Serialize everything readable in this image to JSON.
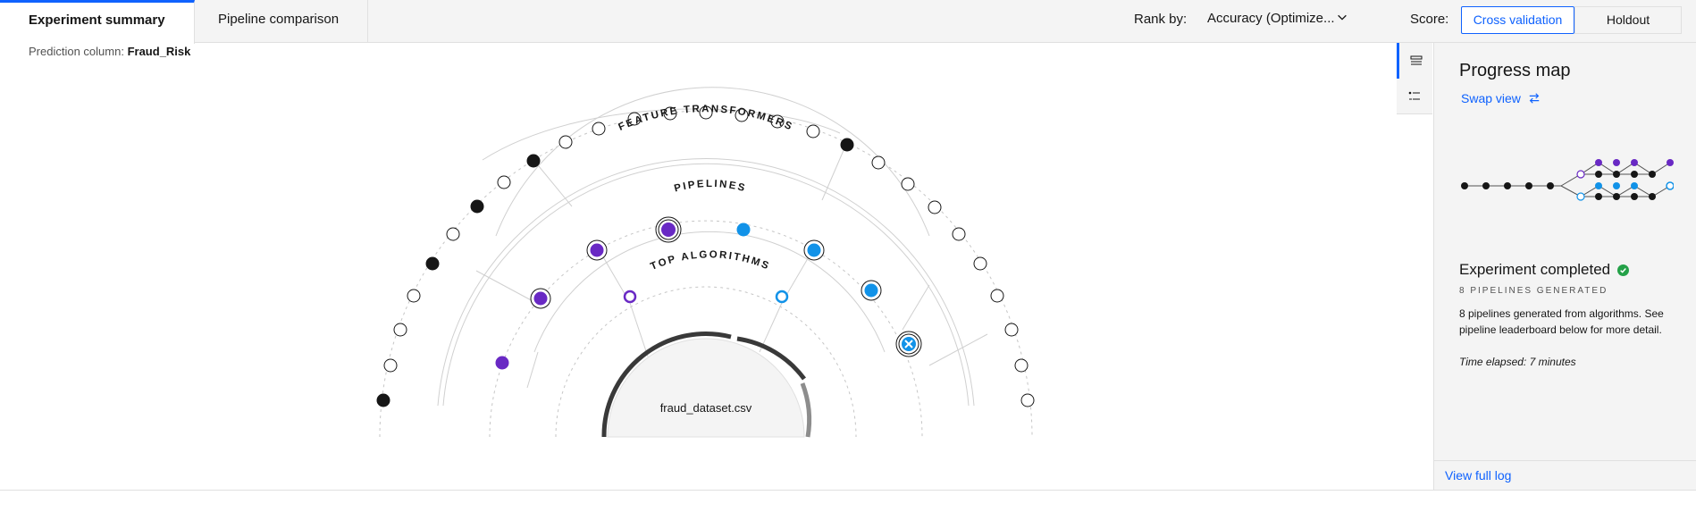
{
  "tabs": [
    {
      "label": "Experiment summary"
    },
    {
      "label": "Pipeline comparison"
    }
  ],
  "rank": {
    "label": "Rank by:",
    "value": "Accuracy (Optimize..."
  },
  "score": {
    "label": "Score:",
    "options": [
      "Cross validation",
      "Holdout"
    ]
  },
  "prediction": {
    "label": "Prediction column:",
    "value": "Fraud_Risk"
  },
  "visualization": {
    "ring_feature": "FEATURE TRANSFORMERS",
    "ring_pipelines": "PIPELINES",
    "ring_algorithms": "TOP ALGORITHMS",
    "dataset": "fraud_dataset.csv"
  },
  "panel": {
    "title": "Progress map",
    "swap": "Swap view",
    "status": "Experiment completed",
    "pipelines_generated": "8 PIPELINES GENERATED",
    "description": "8 pipelines generated from algorithms. See pipeline leaderboard below for more detail.",
    "elapsed": "Time elapsed: 7 minutes",
    "view_log": "View full log"
  },
  "colors": {
    "accent": "#0f62fe",
    "purple": "#6929c4",
    "cyan": "#1192e8",
    "success": "#24a148"
  },
  "icons": [
    "chevron-down-icon",
    "list-view-icon",
    "detail-list-icon",
    "swap-icon",
    "checkmark-filled-icon"
  ]
}
